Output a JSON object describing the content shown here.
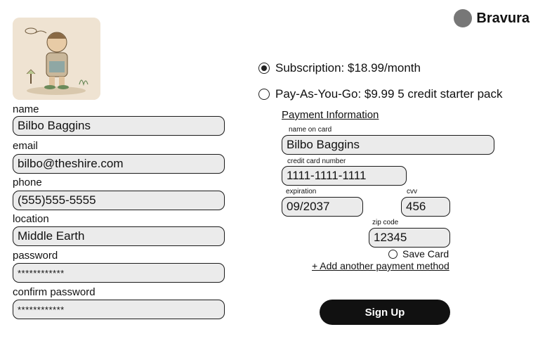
{
  "brand": {
    "name": "Bravura"
  },
  "profile": {
    "fields": [
      {
        "label": "name",
        "value": "Bilbo Baggins"
      },
      {
        "label": "email",
        "value": "bilbo@theshire.com"
      },
      {
        "label": "phone",
        "value": "(555)555-5555"
      },
      {
        "label": "location",
        "value": "Middle Earth"
      },
      {
        "label": "password",
        "value": "************"
      },
      {
        "label": "confirm password",
        "value": "************"
      }
    ]
  },
  "plans": [
    {
      "label": "Subscription: $18.99/month",
      "selected": true
    },
    {
      "label": "Pay-As-You-Go: $9.99 5 credit starter pack",
      "selected": false
    }
  ],
  "payment": {
    "title": "Payment Information",
    "name_on_card": {
      "label": "name on card",
      "value": "Bilbo Baggins"
    },
    "card_number": {
      "label": "credit card number",
      "value": "1111-1111-1111"
    },
    "expiration": {
      "label": "expiration",
      "value": "09/2037"
    },
    "cvv": {
      "label": "cvv",
      "value": "456"
    },
    "zip": {
      "label": "zip code",
      "value": "12345"
    },
    "save_card_label": "Save Card",
    "add_method_label": "+ Add another payment method"
  },
  "signup_label": "Sign Up"
}
